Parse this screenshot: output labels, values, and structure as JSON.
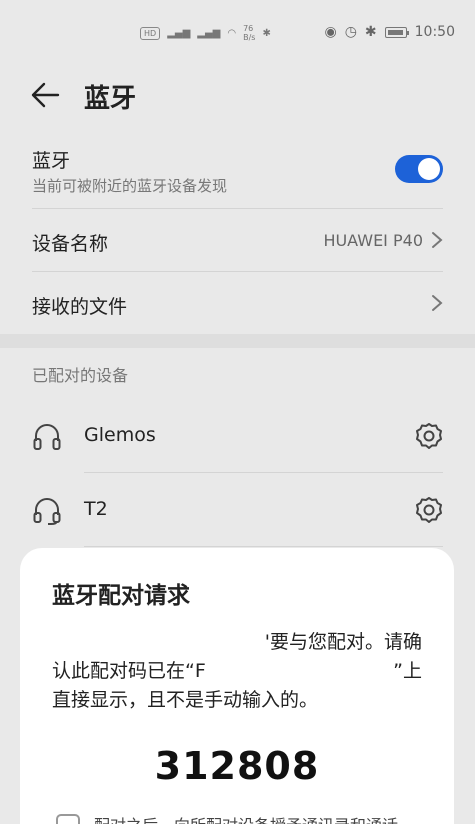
{
  "status_bar": {
    "time": "10:50",
    "left_badge": "HD",
    "net_speed_value": "76",
    "net_speed_unit": "B/s",
    "battery": ""
  },
  "header": {
    "title": "蓝牙",
    "back_icon": "arrow-left-icon"
  },
  "bluetooth": {
    "label": "蓝牙",
    "subtitle": "当前可被附近的蓝牙设备发现",
    "enabled": true,
    "toggle_color": "#1d62d8"
  },
  "device_name": {
    "label": "设备名称",
    "value": "HUAWEI P40"
  },
  "received_files": {
    "label": "接收的文件"
  },
  "paired_section": {
    "header": "已配对的设备",
    "devices": [
      {
        "name": "Glemos",
        "icon": "headphones-icon"
      },
      {
        "name": "T2",
        "icon": "headset-icon"
      }
    ]
  },
  "dialog": {
    "title": "蓝牙配对请求",
    "message_line1": "'要与您配对。请确",
    "message_line2": "认此配对码已在“F",
    "message_line2_end": "”上",
    "message_line3": "直接显示，且不是手动输入的。",
    "code": "312808",
    "checkbox_label": "配对之后，向所配对设备授予通讯录和通话"
  }
}
